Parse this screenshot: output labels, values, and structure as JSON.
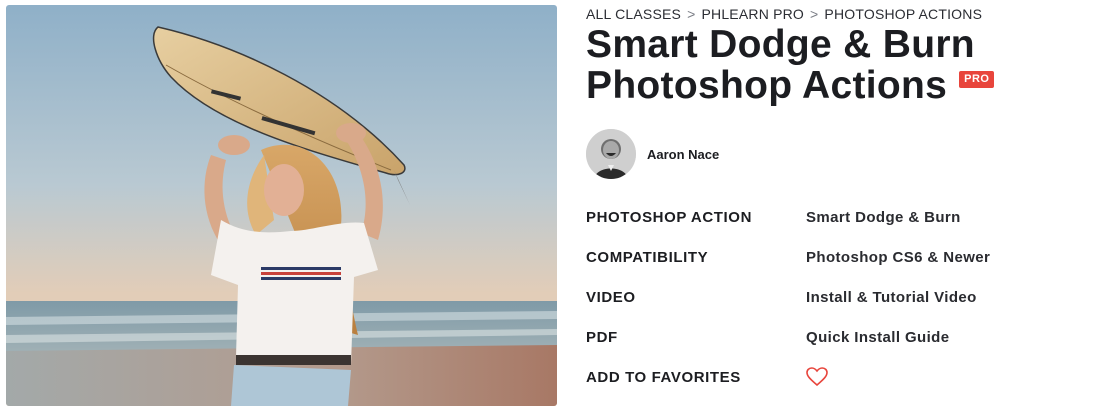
{
  "breadcrumb": {
    "items": [
      "ALL CLASSES",
      "PHLEARN PRO",
      "PHOTOSHOP ACTIONS"
    ],
    "separator": ">"
  },
  "title": {
    "line1": "Smart Dodge & Burn",
    "line2": "Photoshop Actions"
  },
  "badge": {
    "label": "PRO",
    "color": "#e8453c"
  },
  "author": {
    "name": "Aaron Nace"
  },
  "details": [
    {
      "key": "PHOTOSHOP ACTION",
      "value": "Smart Dodge & Burn"
    },
    {
      "key": "COMPATIBILITY",
      "value": "Photoshop CS6 & Newer"
    },
    {
      "key": "VIDEO",
      "value": "Install & Tutorial Video"
    },
    {
      "key": "PDF",
      "value": "Quick Install Guide"
    },
    {
      "key": "ADD TO FAVORITES",
      "icon": "heart-icon"
    }
  ],
  "colors": {
    "accent": "#e8453c",
    "text": "#1c1d21"
  }
}
